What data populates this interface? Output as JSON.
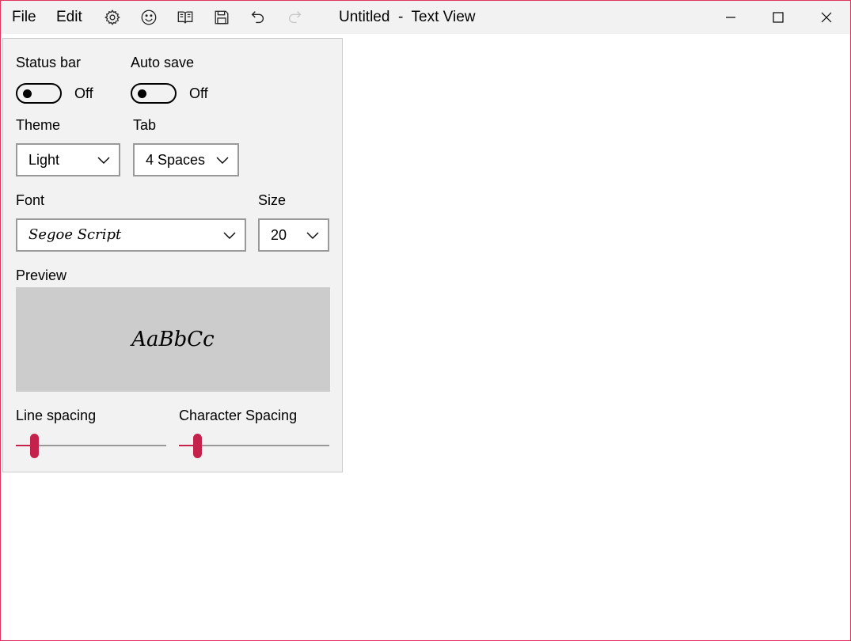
{
  "window": {
    "title": "Untitled  -  Text View",
    "accent": "#c5214d",
    "border_color": "#e0355f"
  },
  "menu": {
    "file": "File",
    "edit": "Edit"
  },
  "toolbar_icons": [
    "gear-icon",
    "smiley-icon",
    "book-icon",
    "save-icon",
    "undo-icon",
    "redo-icon"
  ],
  "settings": {
    "status_bar": {
      "label": "Status bar",
      "state": "Off"
    },
    "auto_save": {
      "label": "Auto save",
      "state": "Off"
    },
    "theme": {
      "label": "Theme",
      "value": "Light"
    },
    "tab": {
      "label": "Tab",
      "value": "4 Spaces"
    },
    "font": {
      "label": "Font",
      "value": "Segoe Script"
    },
    "size": {
      "label": "Size",
      "value": "20"
    },
    "preview": {
      "label": "Preview",
      "text": "AaBbCc"
    },
    "line_spacing": {
      "label": "Line spacing",
      "level": 0.1
    },
    "character_spacing": {
      "label": "Character Spacing",
      "level": 0.1
    }
  }
}
